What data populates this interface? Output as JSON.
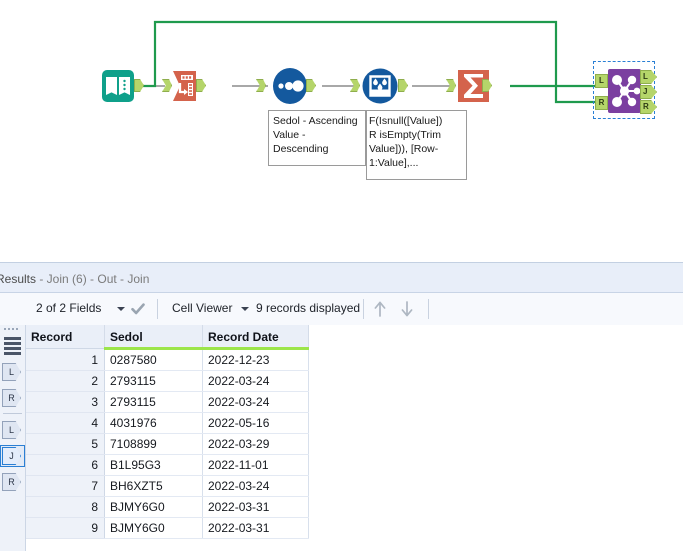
{
  "canvas": {
    "tools": [
      {
        "id": "input-data",
        "name": "Input Data",
        "icon": "book-icon",
        "color": "#0fa08a"
      },
      {
        "id": "select",
        "name": "Select",
        "icon": "select-table-icon",
        "color": "#d4634c"
      },
      {
        "id": "sort",
        "name": "Sort",
        "icon": "sort-dots-icon",
        "color": "#14599e"
      },
      {
        "id": "multi-row-formula",
        "name": "Multi-Row Formula",
        "icon": "beaker-drops-icon",
        "color": "#14599e"
      },
      {
        "id": "summarize",
        "name": "Summarize",
        "icon": "sigma-icon",
        "color": "#d4634c"
      },
      {
        "id": "join",
        "name": "Join",
        "icon": "join-nodes-icon",
        "color": "#7b3fa0",
        "selected": true
      }
    ],
    "annotations": {
      "sort": "Sedol - Ascending\nValue -\nDescending",
      "formula": "F(Isnull([Value])\nR isEmpty(Trim\nValue])), [Row-\n1:Value],..."
    },
    "join_ports": {
      "inputs": [
        "L",
        "R"
      ],
      "outputs": [
        "L",
        "J",
        "R"
      ]
    },
    "wire_color": "#1f9a4d",
    "idle_wire_color": "#a8a8a8",
    "selection_color": "#2a7fd4"
  },
  "results": {
    "title_prefix": "Results",
    "title_rest": " - Join (6) - Out - Join",
    "toolbar": {
      "fields_label": "2 of 2 Fields",
      "viewer_label": "Cell Viewer",
      "records_label": "9 records displayed",
      "check_icon": "checkmark-icon",
      "up_icon": "arrow-up-icon",
      "down_icon": "arrow-down-icon"
    },
    "rail": {
      "grip_icon": "drag-grip-icon",
      "stack_icon": "record-stack-icon",
      "inputs": [
        "L",
        "R"
      ],
      "outputs": [
        "L",
        "J",
        "R"
      ],
      "selected_output": "J"
    },
    "grid": {
      "columns": [
        "Record",
        "Sedol",
        "Record Date"
      ],
      "rows": [
        {
          "record": "1",
          "sedol": "0287580",
          "date": "2022-12-23"
        },
        {
          "record": "2",
          "sedol": "2793115",
          "date": "2022-03-24"
        },
        {
          "record": "3",
          "sedol": "2793115",
          "date": "2022-03-24"
        },
        {
          "record": "4",
          "sedol": "4031976",
          "date": "2022-05-16"
        },
        {
          "record": "5",
          "sedol": "7108899",
          "date": "2022-03-29"
        },
        {
          "record": "6",
          "sedol": "B1L95G3",
          "date": "2022-11-01"
        },
        {
          "record": "7",
          "sedol": "BH6XZT5",
          "date": "2022-03-24"
        },
        {
          "record": "8",
          "sedol": "BJMY6G0",
          "date": "2022-03-31"
        },
        {
          "record": "9",
          "sedol": "BJMY6G0",
          "date": "2022-03-31"
        }
      ]
    }
  }
}
